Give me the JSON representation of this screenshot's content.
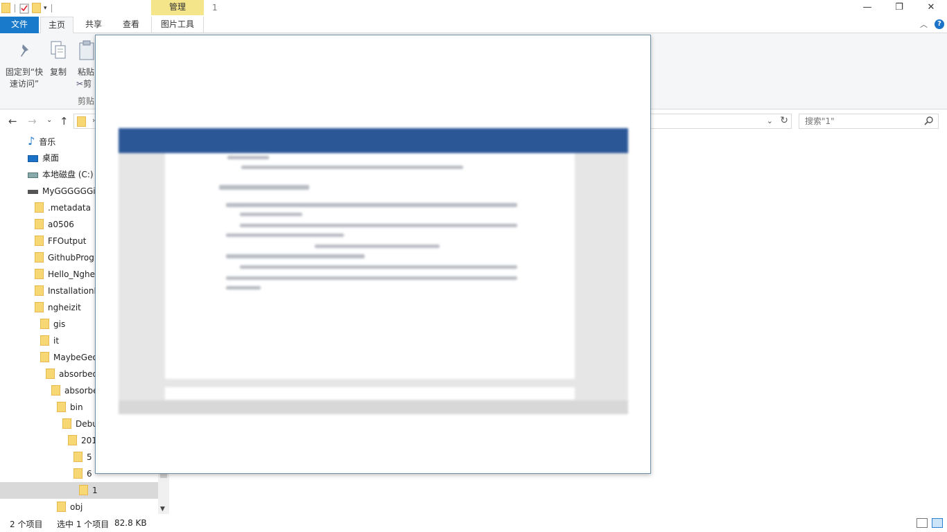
{
  "titlebar": {
    "manage_tab": "管理",
    "title": "1"
  },
  "tabs": {
    "file": "文件",
    "home": "主页",
    "share": "共享",
    "view": "查看",
    "picture_tools": "图片工具"
  },
  "ribbon": {
    "pin_line1": "固定到“快",
    "pin_line2": "速访问”",
    "copy": "复制",
    "paste": "粘贴",
    "cut": "剪",
    "clipboard_group": "剪贴"
  },
  "search": {
    "placeholder": "搜索\"1\""
  },
  "tree": {
    "music": "音乐",
    "desktop": "桌面",
    "local_disk": "本地磁盘 (C:)",
    "drive": "MyGGGGGGi",
    "metadata": ".metadata",
    "a0506": "a0506",
    "ffoutput": "FFOutput",
    "github": "GithubProgr",
    "hello": "Hello_Nghe",
    "installation": "InstallationF",
    "ngheizit": "ngheizit",
    "gis": "gis",
    "it": "it",
    "maybegeo": "MaybeGeo",
    "absorbed1": "absorbed",
    "absorbed2": "absorbe",
    "bin": "bin",
    "debug": "Debu",
    "y201": "201",
    "f5": "5",
    "f6": "6",
    "f1": "1",
    "obj": "obj"
  },
  "status": {
    "count": "2 个项目",
    "selected": "选中 1 个项目",
    "size": "82.8 KB"
  }
}
